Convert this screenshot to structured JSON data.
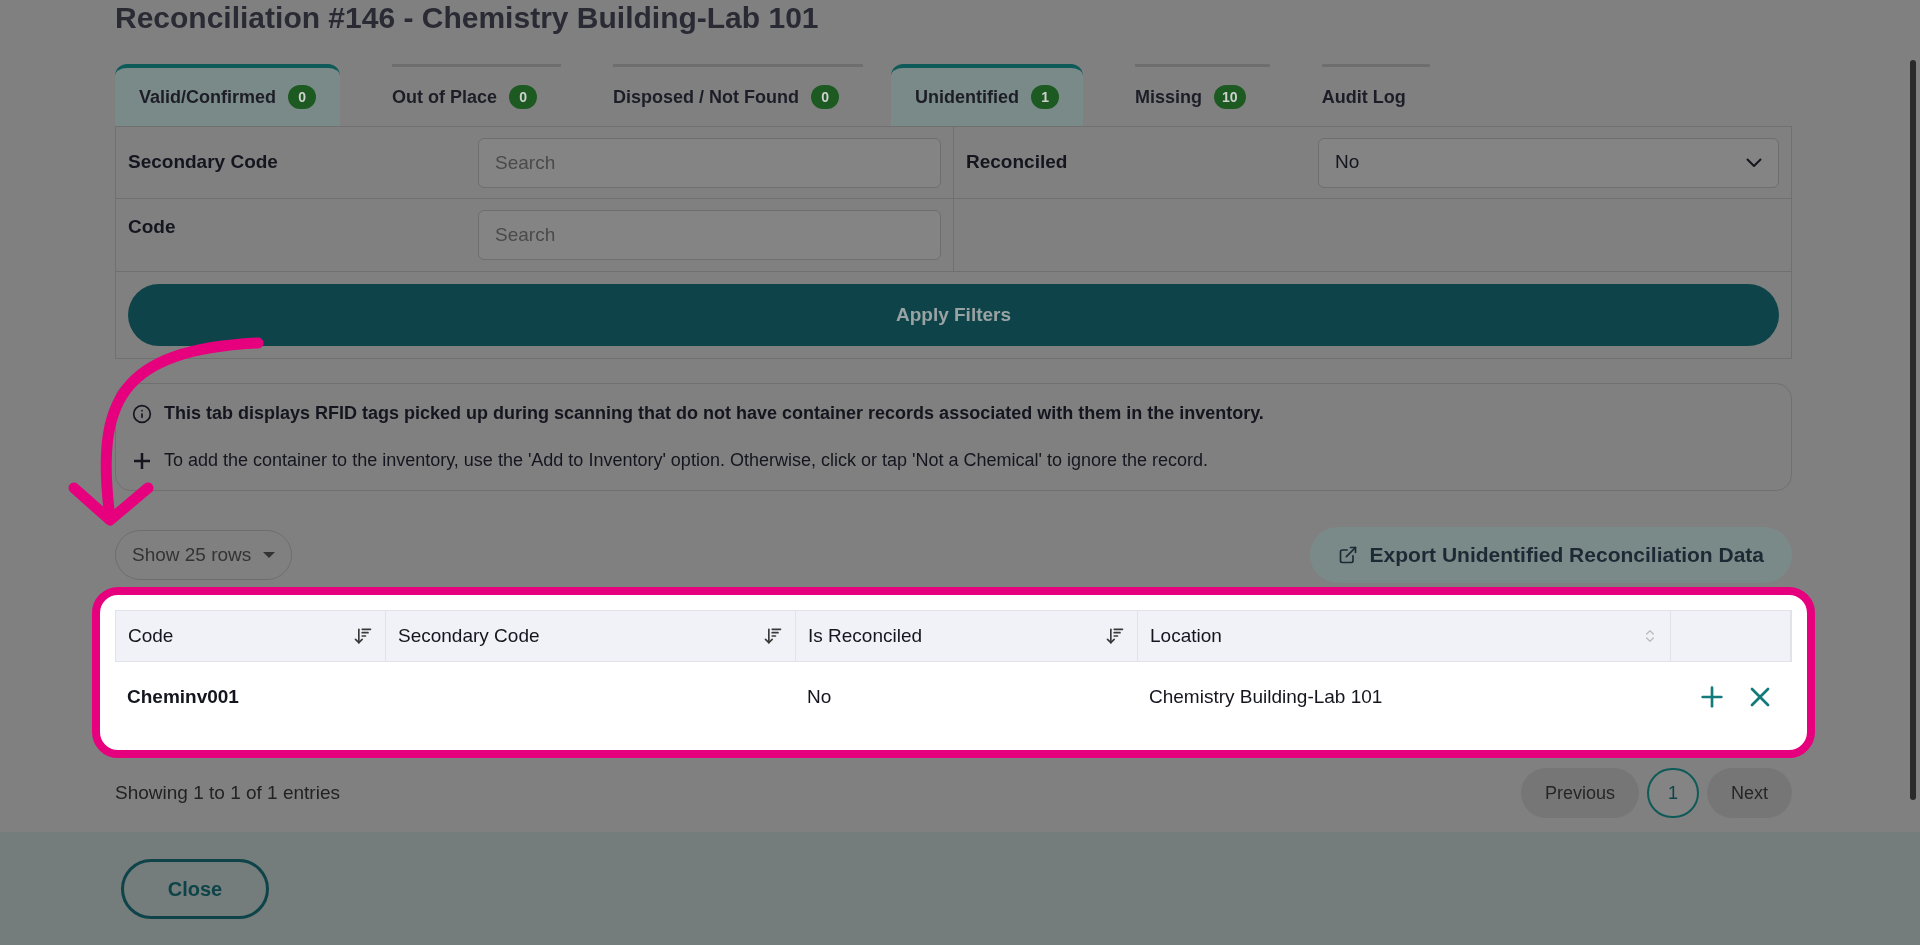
{
  "title": "Reconciliation #146 - Chemistry Building-Lab 101",
  "tabs": [
    {
      "label": "Valid/Confirmed",
      "count": "0",
      "selected": true
    },
    {
      "label": "Out of Place",
      "count": "0",
      "selected": false
    },
    {
      "label": "Disposed / Not Found",
      "count": "0",
      "selected": false
    },
    {
      "label": "Unidentified",
      "count": "1",
      "selected": true
    },
    {
      "label": "Missing",
      "count": "10",
      "selected": false
    },
    {
      "label": "Audit Log",
      "selected": false
    }
  ],
  "filters": {
    "secondary_code": {
      "label": "Secondary Code",
      "placeholder": "Search"
    },
    "code": {
      "label": "Code",
      "placeholder": "Search"
    },
    "reconciled": {
      "label": "Reconciled",
      "value": "No"
    },
    "apply_button": "Apply Filters"
  },
  "info": [
    "This tab displays RFID tags picked up during scanning that do not have container records associated with them in the inventory.",
    "To add the container to the inventory, use the 'Add to Inventory' option. Otherwise, click or tap 'Not a Chemical' to ignore the record."
  ],
  "page_size": "Show 25 rows",
  "export_button": "Export Unidentified Reconciliation Data",
  "table": {
    "columns": [
      {
        "label": "Code",
        "kind": "sorted"
      },
      {
        "label": "Secondary Code",
        "kind": "sorted"
      },
      {
        "label": "Is Reconciled",
        "kind": "sorted"
      },
      {
        "label": "Location",
        "kind": "sortable"
      },
      {
        "kind": "actions"
      }
    ],
    "rows": [
      {
        "code": "Cheminv001",
        "is_reconciled": "No",
        "location": "Chemistry Building-Lab 101"
      }
    ]
  },
  "entries": "Showing 1 to 1 of 1 entries",
  "pagination": [
    {
      "label": "Previous",
      "kind": "nav",
      "selected": false
    },
    {
      "label": "1",
      "kind": "page",
      "selected": true
    },
    {
      "label": "Next",
      "kind": "nav",
      "selected": false
    }
  ],
  "close_button": "Close"
}
